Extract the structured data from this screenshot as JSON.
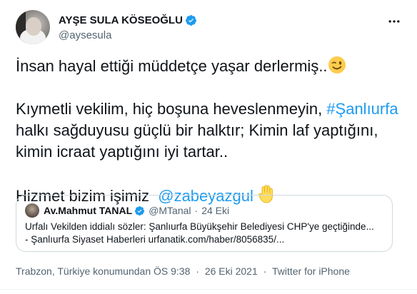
{
  "author": {
    "display_name": "AYŞE SULA KÖSEOĞLU",
    "handle": "@aysesula"
  },
  "tweet": {
    "line1": "İnsan hayal ettiği müddetçe yaşar derlermiş..",
    "line2_pre": "Kıymetli vekilim, hiç boşuna heveslenmeyin, ",
    "hashtag": "#Şanlıurfa",
    "line3": "halkı sağduyusu güçlü bir halktır; Kimin laf yaptığını,",
    "line4": "kimin icraat yaptığını iyi tartar..",
    "line5_pre": "Hizmet bizim işimiz  ",
    "mention": "@zabeyazgul"
  },
  "quote": {
    "name": "Av.Mahmut TANAL",
    "handle": "@MTanal",
    "dot": "·",
    "date": "24 Eki",
    "text_line1": "Urfalı Vekilden iddialı sözler: Şanlıurfa Büyükşehir Belediyesi CHP'ye geçtiğinde...",
    "text_line2": "- Şanlıurfa Siyaset Haberleri urfanatik.com/haber/8056835/..."
  },
  "meta": {
    "location": "Trabzon, Türkiye konumundan ÖS 9:38",
    "date": "26 Eki 2021",
    "source": "Twitter for iPhone",
    "dot": "·"
  },
  "colors": {
    "link": "#1d9bf0",
    "secondary_text": "#536471",
    "border": "#cfd9de"
  },
  "icons": [
    "verified-badge-icon",
    "more-options-icon",
    "winking-face-emoji",
    "raised-hand-emoji"
  ]
}
